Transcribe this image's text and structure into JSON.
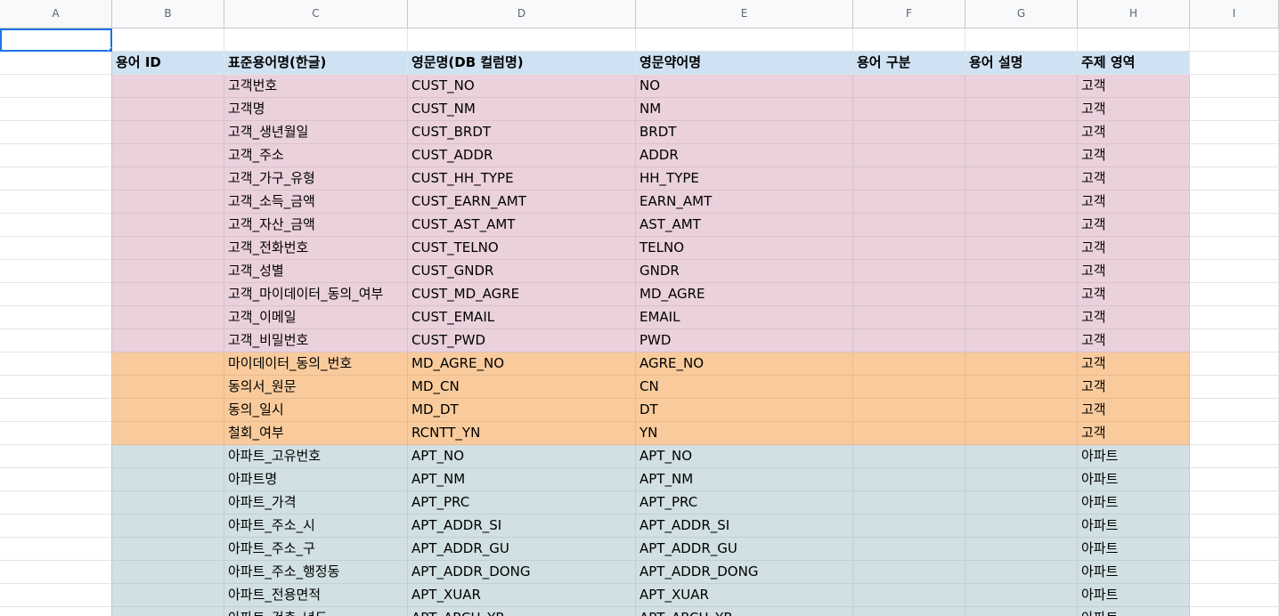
{
  "column_headers": [
    "A",
    "B",
    "C",
    "D",
    "E",
    "F",
    "G",
    "H",
    "I"
  ],
  "header_row": {
    "term_id": "용어 ID",
    "std_term_kr": "표준용어명(한글)",
    "eng_db_col": "영문명(DB 컬럼명)",
    "eng_abbr": "영문약어명",
    "term_type": "용어 구분",
    "term_desc": "용어 설명",
    "subject_area": "주제 영역"
  },
  "rows": [
    {
      "band": "pink",
      "kr": "고객번호",
      "col": "CUST_NO",
      "abbr": "NO",
      "area": "고객"
    },
    {
      "band": "pink",
      "kr": "고객명",
      "col": "CUST_NM",
      "abbr": "NM",
      "area": "고객"
    },
    {
      "band": "pink",
      "kr": "고객_생년월일",
      "col": "CUST_BRDT",
      "abbr": "BRDT",
      "area": "고객"
    },
    {
      "band": "pink",
      "kr": "고객_주소",
      "col": "CUST_ADDR",
      "abbr": "ADDR",
      "area": "고객"
    },
    {
      "band": "pink",
      "kr": "고객_가구_유형",
      "col": "CUST_HH_TYPE",
      "abbr": "HH_TYPE",
      "area": "고객"
    },
    {
      "band": "pink",
      "kr": "고객_소득_금액",
      "col": "CUST_EARN_AMT",
      "abbr": "EARN_AMT",
      "area": "고객"
    },
    {
      "band": "pink",
      "kr": "고객_자산_금액",
      "col": "CUST_AST_AMT",
      "abbr": "AST_AMT",
      "area": "고객"
    },
    {
      "band": "pink",
      "kr": "고객_전화번호",
      "col": "CUST_TELNO",
      "abbr": "TELNO",
      "area": "고객"
    },
    {
      "band": "pink",
      "kr": "고객_성별",
      "col": "CUST_GNDR",
      "abbr": "GNDR",
      "area": "고객"
    },
    {
      "band": "pink",
      "kr": "고객_마이데이터_동의_여부",
      "col": "CUST_MD_AGRE",
      "abbr": "MD_AGRE",
      "area": "고객"
    },
    {
      "band": "pink",
      "kr": "고객_이메일",
      "col": "CUST_EMAIL",
      "abbr": "EMAIL",
      "area": "고객"
    },
    {
      "band": "pink",
      "kr": "고객_비밀번호",
      "col": "CUST_PWD",
      "abbr": "PWD",
      "area": "고객"
    },
    {
      "band": "orange",
      "kr": "마이데이터_동의_번호",
      "col": "MD_AGRE_NO",
      "abbr": "AGRE_NO",
      "area": "고객"
    },
    {
      "band": "orange",
      "kr": "동의서_원문",
      "col": "MD_CN",
      "abbr": "CN",
      "area": "고객"
    },
    {
      "band": "orange",
      "kr": "동의_일시",
      "col": "MD_DT",
      "abbr": "DT",
      "area": "고객"
    },
    {
      "band": "orange",
      "kr": "철회_여부",
      "col": "RCNTT_YN",
      "abbr": "YN",
      "area": "고객"
    },
    {
      "band": "teal",
      "kr": "아파트_고유번호",
      "col": "APT_NO",
      "abbr": "APT_NO",
      "area": "아파트"
    },
    {
      "band": "teal",
      "kr": "아파트명",
      "col": "APT_NM",
      "abbr": "APT_NM",
      "area": "아파트"
    },
    {
      "band": "teal",
      "kr": "아파트_가격",
      "col": "APT_PRC",
      "abbr": "APT_PRC",
      "area": "아파트"
    },
    {
      "band": "teal",
      "kr": "아파트_주소_시",
      "col": "APT_ADDR_SI",
      "abbr": "APT_ADDR_SI",
      "area": "아파트"
    },
    {
      "band": "teal",
      "kr": "아파트_주소_구",
      "col": "APT_ADDR_GU",
      "abbr": "APT_ADDR_GU",
      "area": "아파트"
    },
    {
      "band": "teal",
      "kr": "아파트_주소_행정동",
      "col": "APT_ADDR_DONG",
      "abbr": "APT_ADDR_DONG",
      "area": "아파트"
    },
    {
      "band": "teal",
      "kr": "아파트_전용면적",
      "col": "APT_XUAR",
      "abbr": "APT_XUAR",
      "area": "아파트"
    },
    {
      "band": "teal",
      "kr": "아파트_건축_년도",
      "col": "APT_ARCH_YR",
      "abbr": "APT_ARCH_YR",
      "area": "아파트"
    }
  ]
}
